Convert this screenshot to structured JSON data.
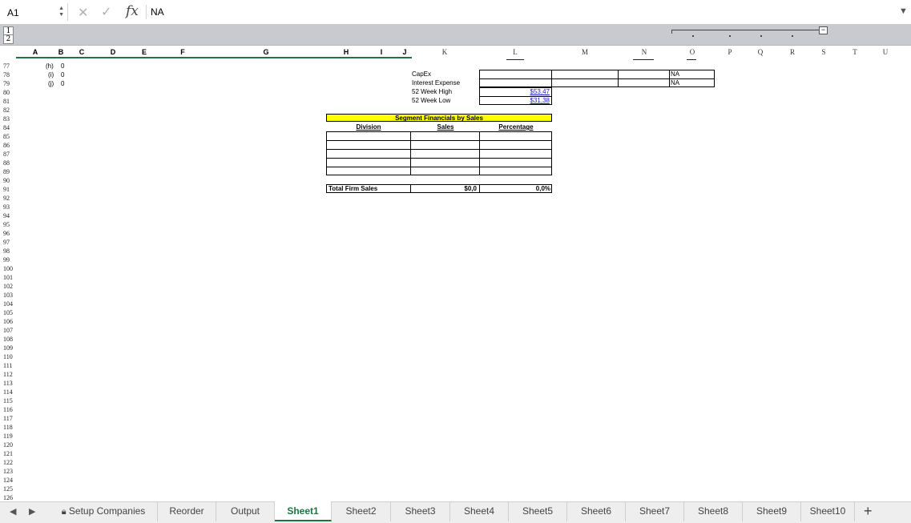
{
  "formula_bar": {
    "cell_ref": "A1",
    "value": "NA",
    "fx": "fx"
  },
  "outline": {
    "levels": [
      "1",
      "2"
    ],
    "collapse": "−"
  },
  "columns": [
    "A",
    "B",
    "C",
    "D",
    "E",
    "F",
    "G",
    "H",
    "I",
    "J",
    "K",
    "L",
    "M",
    "N",
    "O",
    "P",
    "Q",
    "R",
    "S",
    "T",
    "U"
  ],
  "rows": [
    "77",
    "78",
    "79",
    "80",
    "81",
    "82",
    "83",
    "84",
    "85",
    "86",
    "87",
    "88",
    "89",
    "90",
    "91",
    "92",
    "93",
    "94",
    "95",
    "96",
    "97",
    "98",
    "99",
    "100",
    "101",
    "102",
    "103",
    "104",
    "105",
    "106",
    "107",
    "108",
    "109",
    "110",
    "111",
    "112",
    "113",
    "114",
    "115",
    "116",
    "117",
    "118",
    "119",
    "120",
    "121",
    "122",
    "123",
    "124",
    "125",
    "126"
  ],
  "cells": {
    "list": [
      {
        "label": "(h)",
        "value": "0"
      },
      {
        "label": "(i)",
        "value": "0"
      },
      {
        "label": "(j)",
        "value": "0"
      }
    ],
    "metrics": [
      {
        "label": "CapEx",
        "l": "",
        "o": "NA"
      },
      {
        "label": "Interest Expense",
        "l": "",
        "o": "NA"
      },
      {
        "label": "52 Week High",
        "l": "$53,47",
        "o": ""
      },
      {
        "label": "52 Week Low",
        "l": "$31,38",
        "o": ""
      }
    ],
    "segment": {
      "title": "Segment Financials by Sales",
      "headers": [
        "Division",
        "Sales",
        "Percentage"
      ],
      "total_label": "Total Firm Sales",
      "total_sales": "$0,0",
      "total_pct": "0,0%"
    }
  },
  "sheet_tabs": [
    "Setup Companies",
    "Reorder",
    "Output",
    "Sheet1",
    "Sheet2",
    "Sheet3",
    "Sheet4",
    "Sheet5",
    "Sheet6",
    "Sheet7",
    "Sheet8",
    "Sheet9",
    "Sheet10"
  ],
  "active_tab": "Sheet1",
  "colors": {
    "accent": "#1d7344",
    "highlight": "#ffff00",
    "link": "#1a1adb"
  }
}
